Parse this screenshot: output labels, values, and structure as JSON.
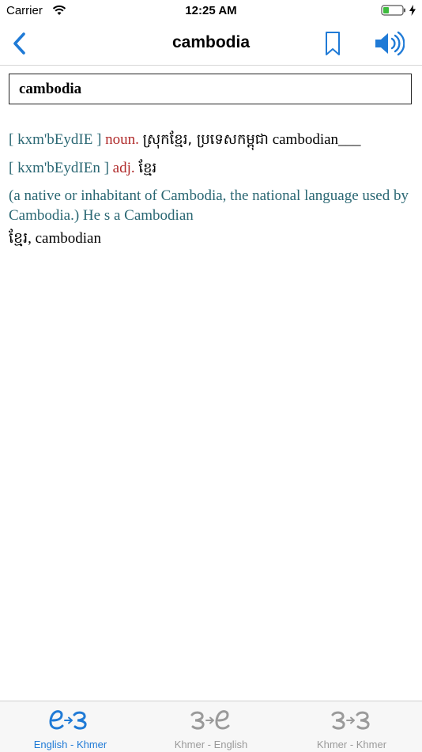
{
  "status_bar": {
    "carrier": "Carrier",
    "time": "12:25 AM"
  },
  "nav": {
    "title": "cambodia"
  },
  "search": {
    "value": "cambodia"
  },
  "entries": [
    {
      "phonetic": "[ kxm'bEydIE ]",
      "pos": "noun.",
      "khmer": "ស្រុកខ្មែរ, ប្រទេសកម្ពុជា",
      "english": "cambodian___"
    },
    {
      "phonetic": "[ kxm'bEydIEn ]",
      "pos": "adj.",
      "khmer": "ខ្មែរ"
    }
  ],
  "definition": "(a native or inhabitant of Cambodia, the national language used by Cambodia.) He s a Cambodian",
  "translation": "ខ្មែរ, cambodian",
  "tabs": [
    {
      "label": "English - Khmer",
      "icon": "e-to-khmer-icon",
      "active": true
    },
    {
      "label": "Khmer - English",
      "icon": "khmer-to-e-icon",
      "active": false
    },
    {
      "label": "Khmer - Khmer",
      "icon": "khmer-to-khmer-icon",
      "active": false
    }
  ],
  "colors": {
    "accent": "#1f7ad6",
    "phonetic": "#2a6773",
    "pos": "#b02a2a",
    "inactive": "#9a9a9a"
  }
}
